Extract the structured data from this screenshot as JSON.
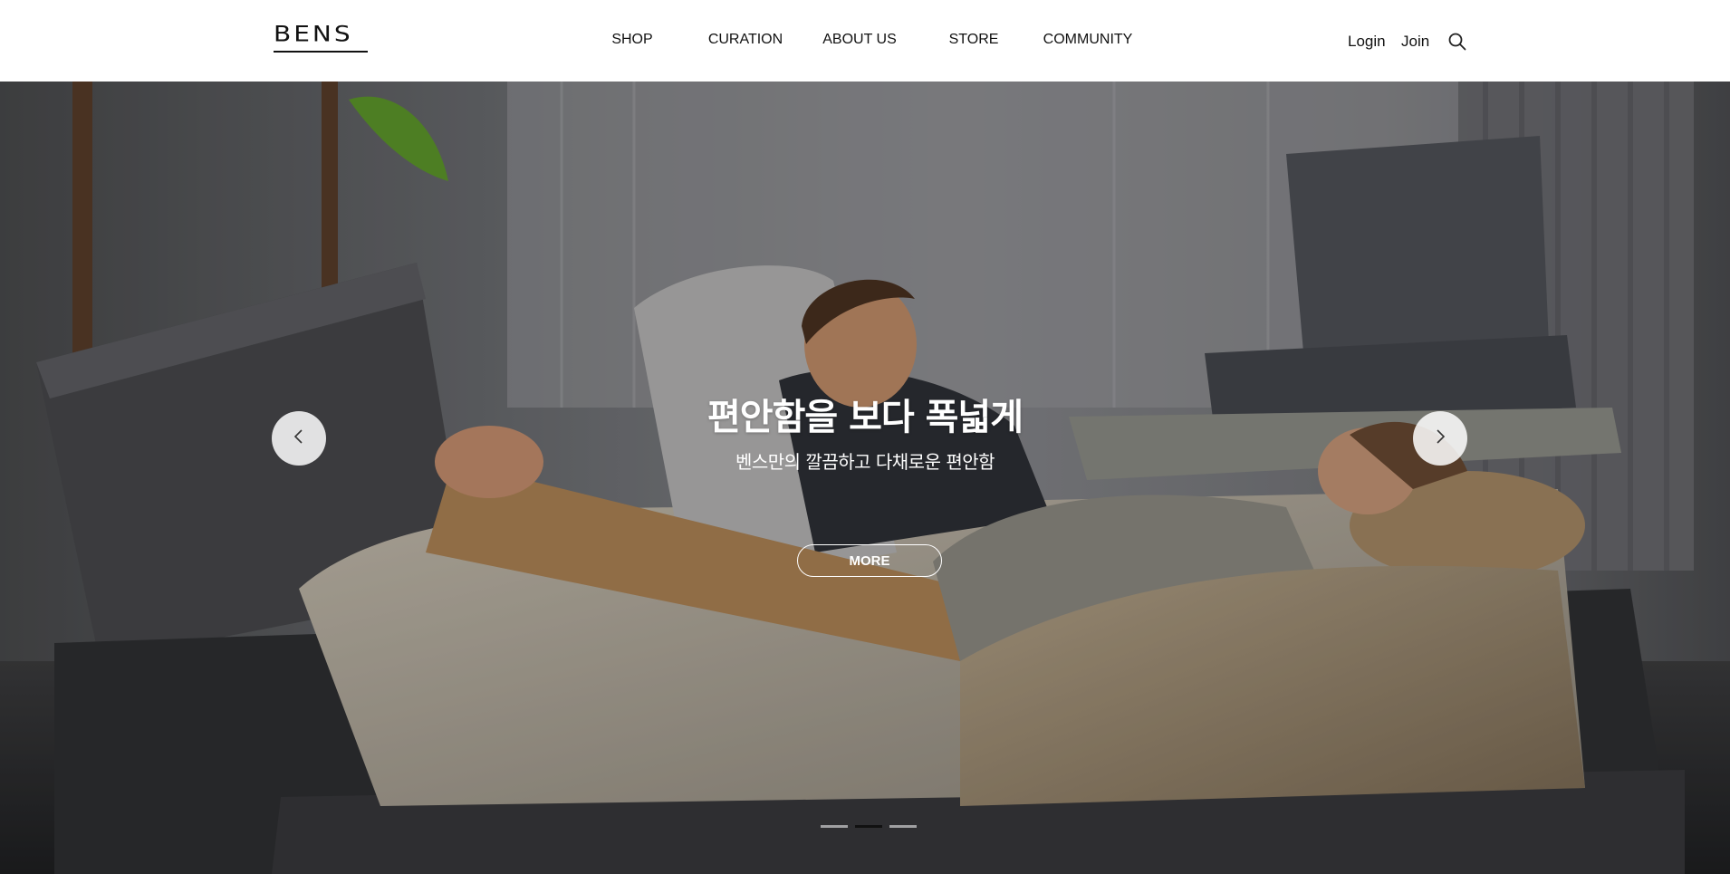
{
  "header": {
    "logo_text": "BENS",
    "nav": [
      {
        "label": "SHOP"
      },
      {
        "label": "CURATION"
      },
      {
        "label": "ABOUT US"
      },
      {
        "label": "STORE"
      },
      {
        "label": "COMMUNITY"
      }
    ],
    "login_label": "Login",
    "join_label": "Join",
    "search_icon": "search-icon"
  },
  "hero": {
    "title": "편안함을 보다 폭넓게",
    "subtitle": "벤스만의 깔끔하고 다채로운 편안함",
    "more_label": "MORE",
    "prev_icon": "chevron-left-icon",
    "next_icon": "chevron-right-icon",
    "slides_total": 3,
    "active_slide": 2
  },
  "colors": {
    "text": "#111111",
    "hero_text": "#ffffff",
    "header_bg": "#ffffff"
  }
}
